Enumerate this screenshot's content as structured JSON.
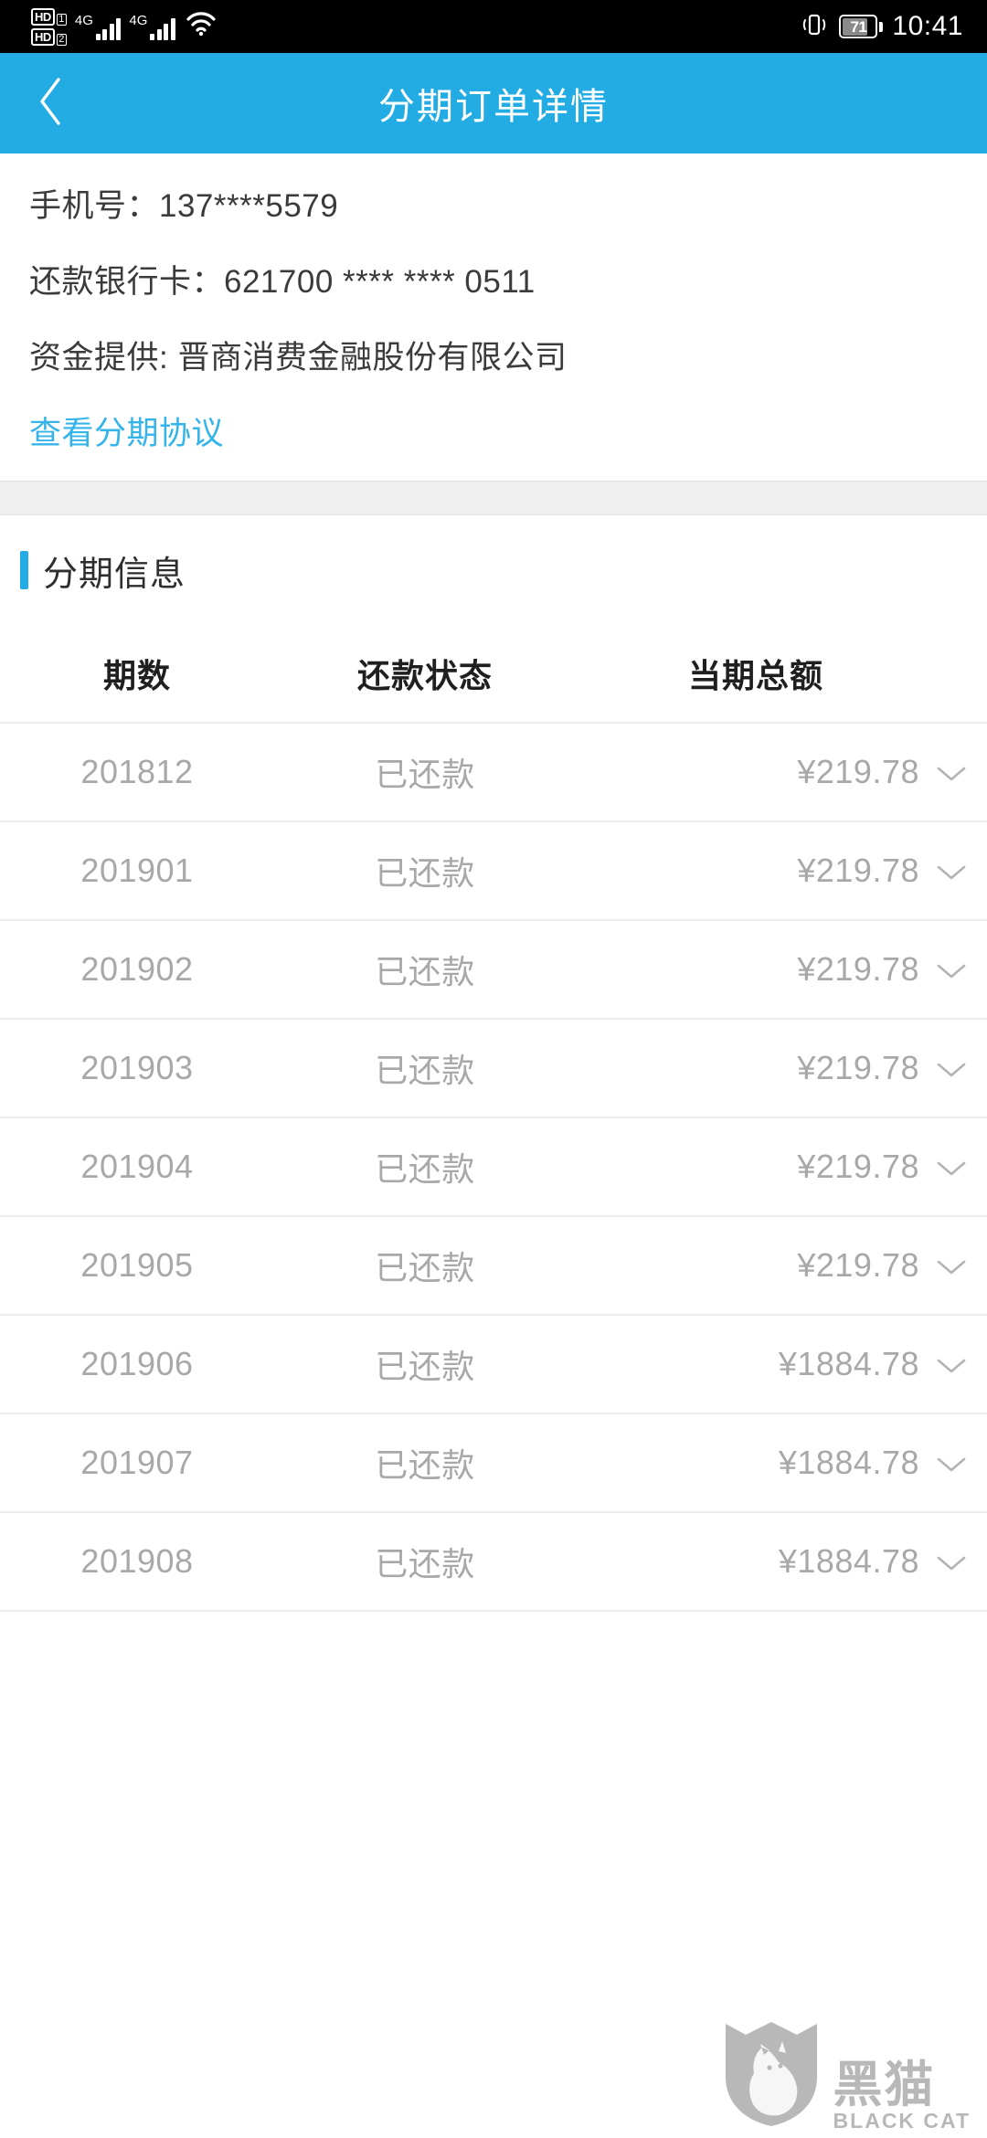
{
  "status_bar": {
    "hd_badge_1": "HD",
    "hd_sub_1": "1",
    "hd_badge_2": "HD",
    "hd_sub_2": "2",
    "network_1": "4G",
    "network_2": "4G",
    "battery_percent": "71",
    "time": "10:41"
  },
  "app_bar": {
    "title": "分期订单详情",
    "back_label": "返回"
  },
  "info": {
    "phone_line": "手机号：137****5579",
    "bank_card_line": "还款银行卡：621700 **** **** 0511",
    "funding_line": "资金提供: 晋商消费金融股份有限公司",
    "agreement_link": "查看分期协议"
  },
  "section": {
    "title": "分期信息"
  },
  "table": {
    "headers": {
      "period": "期数",
      "status": "还款状态",
      "amount": "当期总额"
    },
    "rows": [
      {
        "period": "201812",
        "status": "已还款",
        "amount": "¥219.78"
      },
      {
        "period": "201901",
        "status": "已还款",
        "amount": "¥219.78"
      },
      {
        "period": "201902",
        "status": "已还款",
        "amount": "¥219.78"
      },
      {
        "period": "201903",
        "status": "已还款",
        "amount": "¥219.78"
      },
      {
        "period": "201904",
        "status": "已还款",
        "amount": "¥219.78"
      },
      {
        "period": "201905",
        "status": "已还款",
        "amount": "¥219.78"
      },
      {
        "period": "201906",
        "status": "已还款",
        "amount": "¥1884.78"
      },
      {
        "period": "201907",
        "status": "已还款",
        "amount": "¥1884.78"
      },
      {
        "period": "201908",
        "status": "已还款",
        "amount": "¥1884.78"
      }
    ]
  },
  "watermark": {
    "cn": "黑猫",
    "en": "BLACK CAT"
  },
  "colors": {
    "accent": "#22ace3",
    "link": "#35b4ea",
    "row_text": "#a8a8a8",
    "header_text": "#1f1f1f"
  }
}
